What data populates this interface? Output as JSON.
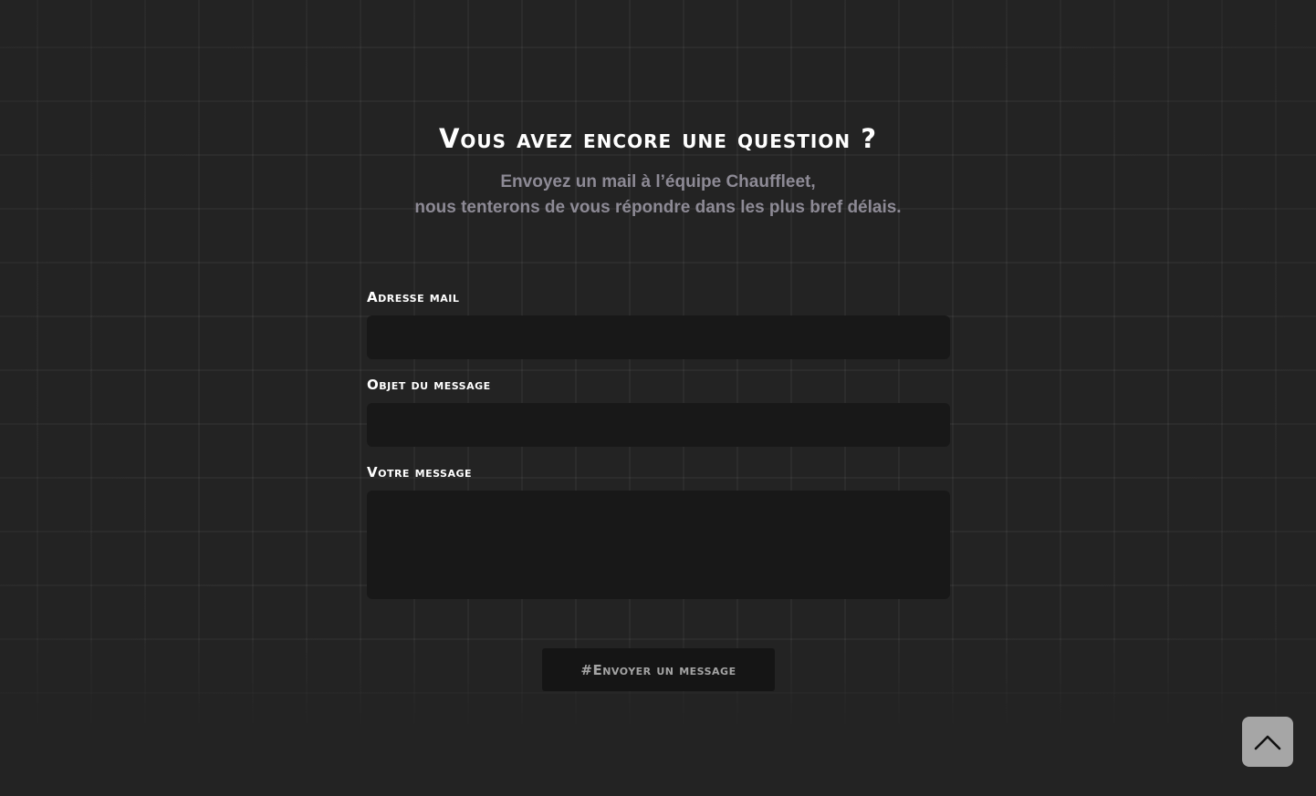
{
  "page": {
    "title": "Vous avez encore une question ?",
    "subtitle_line1": "Envoyez un mail à l’équipe Chauffleet,",
    "subtitle_line2": "nous tenterons de vous répondre dans les plus bref délais."
  },
  "form": {
    "email_label": "Adresse mail",
    "email_value": "",
    "subject_label": "Objet du message",
    "subject_value": "",
    "message_label": "Votre message",
    "message_value": "",
    "submit_label": "#Envoyer un message"
  },
  "scroll_top": {
    "icon": "chevron-up-icon"
  },
  "colors": {
    "background": "#232323",
    "input_background": "#181818",
    "subtitle_text": "#8d8a95",
    "button_background": "#151515",
    "button_text": "#a4a4a4",
    "scroll_button_background": "#a6a6a6"
  }
}
